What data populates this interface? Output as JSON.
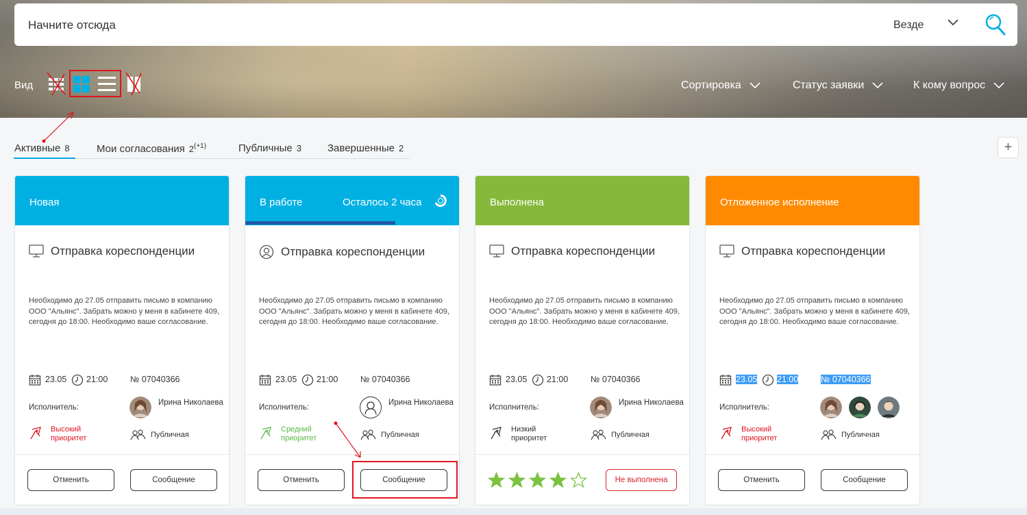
{
  "search": {
    "text": "Начните отсюда",
    "scope": "Везде"
  },
  "view": {
    "label": "Вид"
  },
  "filters": [
    "Сортировка",
    "Статус заявки",
    "К кому вопрос"
  ],
  "tabs": [
    {
      "label": "Активные",
      "count": "8"
    },
    {
      "label": "Мои согласования",
      "count": "2",
      "extra": "(+1)"
    },
    {
      "label": "Публичные",
      "count": "3"
    },
    {
      "label": "Завершенные",
      "count": "2"
    }
  ],
  "add_button": "+",
  "cards": [
    {
      "status": "Новая",
      "color": "#00b0e3",
      "title": "Отправка кореспонденции",
      "desc": "Необходимо до 27.05 отправить письмо в компанию ООО \"Альянс\". Забрать можно у меня в кабинете 409, сегодня до 18:00. Необходимо ваше согласование.",
      "date": "23.05",
      "time": "21:00",
      "number": "№ 07040366",
      "exec_label": "Исполнитель:",
      "exec_name": "Ирина Николаева",
      "priority": "Высокий приоритет",
      "priority_color": "#e0141e",
      "visibility": "Публичная",
      "cancel": "Отменить",
      "message": "Сообщение"
    },
    {
      "status": "В работе",
      "remaining": "Осталось 2 часа",
      "color": "#00b0e3",
      "title": "Отправка кореспонденции",
      "desc": "Необходимо до 27.05 отправить письмо в компанию ООО \"Альянс\". Забрать можно у меня в кабинете 409, сегодня до 18:00. Необходимо ваше согласование.",
      "date": "23.05",
      "time": "21:00",
      "number": "№ 07040366",
      "exec_label": "Исполнитель:",
      "exec_name": "Ирина Николаева",
      "priority": "Средний приоритет",
      "priority_color": "#58b947",
      "visibility": "Публичная",
      "cancel": "Отменить",
      "message": "Сообщение"
    },
    {
      "status": "Выполнена",
      "color": "#86b83b",
      "title": "Отправка кореспонденции",
      "desc": "Необходимо до 27.05 отправить письмо в компанию ООО \"Альянс\". Забрать можно у меня в кабинете 409, сегодня до 18:00. Необходимо ваше согласование.",
      "date": "23.05",
      "time": "21:00",
      "number": "№ 07040366",
      "exec_label": "Исполнитель:",
      "exec_name": "Ирина Николаева",
      "priority": "Низкий приоритет",
      "priority_color": "#333333",
      "visibility": "Публичная",
      "rating": 4,
      "rating_max": 5,
      "not_done": "Не выполнена"
    },
    {
      "status": "Отложенное исполнение",
      "color": "#ff8a00",
      "title": "Отправка кореспонденции",
      "desc": "Необходимо до 27.05 отправить письмо в компанию ООО \"Альянс\". Забрать можно у меня в кабинете 409, сегодня до 18:00. Необходимо ваше согласование.",
      "date": "23.05",
      "time": "21:00",
      "number": "№ 07040366",
      "exec_label": "Исполнитель:",
      "priority": "Высокий приоритет",
      "priority_color": "#e0141e",
      "visibility": "Публичная",
      "cancel": "Отменить",
      "message": "Сообщение"
    }
  ]
}
